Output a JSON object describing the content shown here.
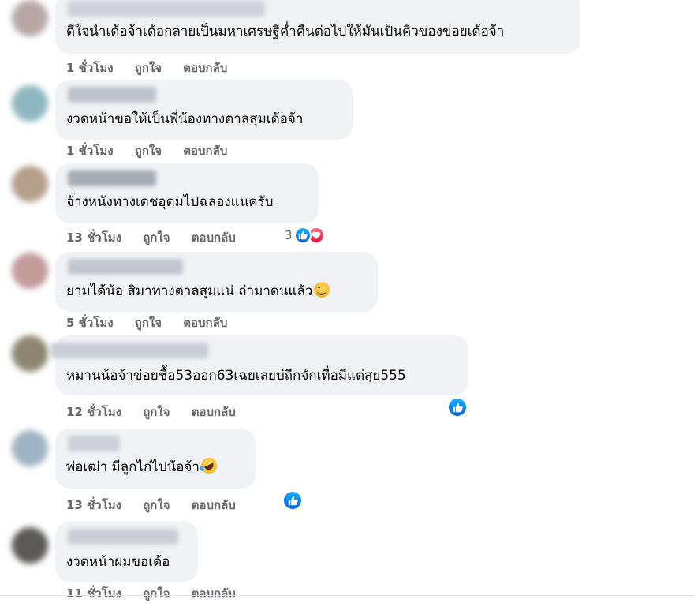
{
  "comments": [
    {
      "text": "ดีใจนำเด้อจ้าเด้อกลายเป็นมหาเศรษฐีค่ำคืนต่อไปให้มันเป็นคิวของข่อยเด้อจ้า",
      "time": "1 ชั่วโมง",
      "like": "ถูกใจ",
      "reply": "ตอบกลับ",
      "avatar_color": "#b9a7a7",
      "author_blur_color": "#c8ccd4"
    },
    {
      "text": "งวดหน้าขอให้เป็นพี่น้องทางตาลสุมเด้อจ้า",
      "time": "1 ชั่วโมง",
      "like": "ถูกใจ",
      "reply": "ตอบกลับ",
      "avatar_color": "#8fb7c2",
      "author_blur_color": "#b7bcc5"
    },
    {
      "text": "จ้างหนังทางเดชอุดมไปฉลองแนครับ",
      "time": "13 ชั่วโมง",
      "like": "ถูกใจ",
      "reply": "ตอบกลับ",
      "reaction_count": "3",
      "reactions": [
        "like-icon",
        "love-icon"
      ],
      "avatar_color": "#b59e8a",
      "author_blur_color": "#9aa0aa"
    },
    {
      "text": "ยามได้น้อ สิมาทางตาลสุมแน่ ถ่ามาดนแล้ว",
      "time": "5 ชั่วโมง",
      "like": "ถูกใจ",
      "reply": "ตอบกลับ",
      "emoji": "smile-icon",
      "avatar_color": "#c49b9b",
      "author_blur_color": "#b9bec7"
    },
    {
      "text": "หมานน้อจ้าข่อยซื้อ53ออก63เฉยเลยบ่ถืกจักเทื่อมีแต่สุย555",
      "time": "12 ชั่วโมง",
      "like": "ถูกใจ",
      "reply": "ตอบกลับ",
      "reactions": [
        "like-icon"
      ],
      "avatar_color": "#8e8670",
      "author_blur_color": "#c3c7cf"
    },
    {
      "text": "พ่อเฒ่า มีลูกไก่ไปน้อจ้า",
      "time": "13 ชั่วโมง",
      "like": "ถูกใจ",
      "reply": "ตอบกลับ",
      "emoji": "rofl-icon",
      "reactions": [
        "like-icon"
      ],
      "avatar_color": "#9fb3c4",
      "author_blur_color": "#c6cad2"
    },
    {
      "text": "งวดหน้าผมขอเด้อ",
      "time": "11 ชั่วโมง",
      "like": "ถูกใจ",
      "reply": "ตอบกลับ",
      "avatar_color": "#5b5a57",
      "author_blur_color": "#c3c7cf"
    }
  ],
  "colors": {
    "bubble": "#f0f2f5",
    "meta_text": "#65676b",
    "like_blue": "#1877f2",
    "love_red": "#f33e58"
  }
}
